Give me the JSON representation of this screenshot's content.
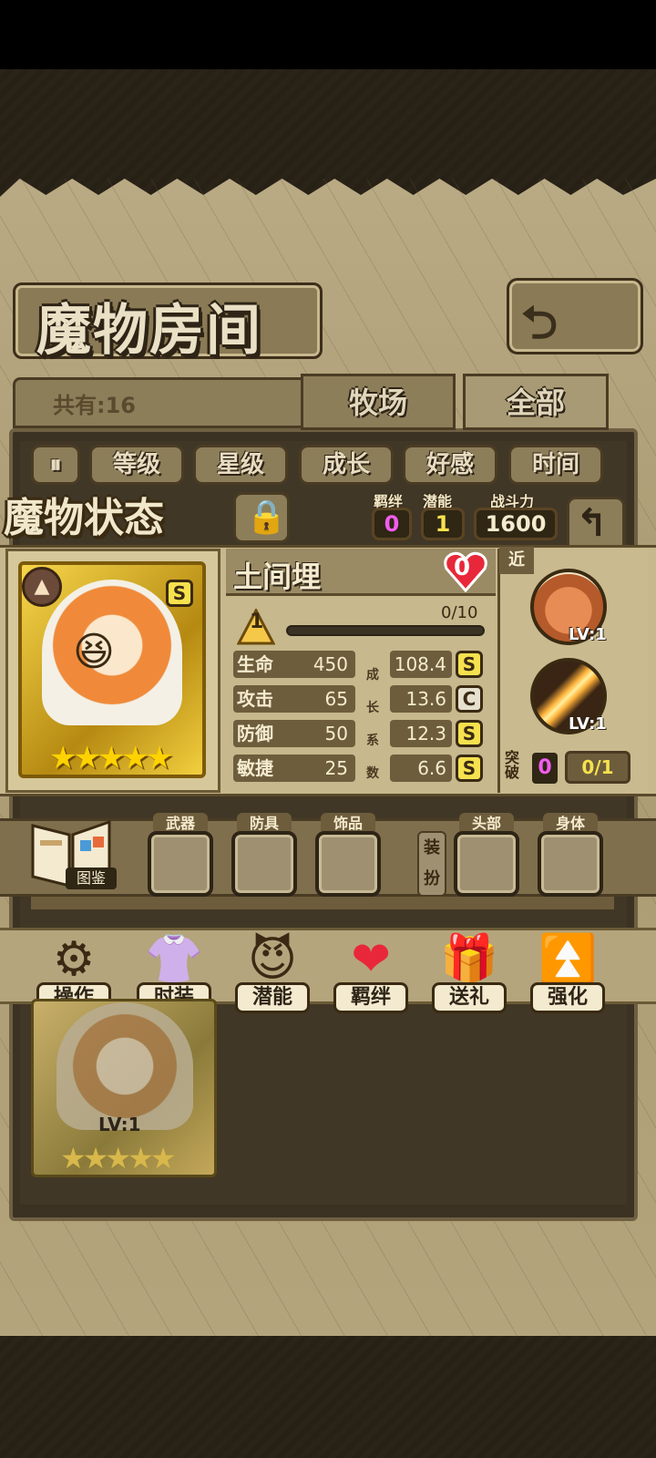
{
  "header": {
    "title": "魔物房间",
    "back_icon": "return-arrow-icon"
  },
  "list": {
    "count_label": "共有:16",
    "tabs": [
      "牧场",
      "全部"
    ],
    "sort_toggle_icon": "sort-toggle-icon",
    "sort_buttons": [
      "等级",
      "星级",
      "成长",
      "好感",
      "时间"
    ],
    "card": {
      "level": "LV:1",
      "stars": "★★★★★"
    }
  },
  "status": {
    "title": "魔物状态",
    "lock_icon": "🔒",
    "bond_label": "羁绊",
    "bond_value": "0",
    "potential_label": "潜能",
    "potential_value": "1",
    "power_label": "战斗力",
    "power_value": "1600",
    "name": "土间埋",
    "affection": "0",
    "element_icon": "mountain-element-icon",
    "rank": "S",
    "stars": "★★★★★",
    "level": "1",
    "exp": "0/10",
    "exp_progress": 0,
    "growth_chars": [
      "成",
      "长",
      "系",
      "数"
    ],
    "stats": [
      {
        "label": "生命",
        "value": "450",
        "growth": "108.4",
        "grade": "S"
      },
      {
        "label": "攻击",
        "value": "65",
        "growth": "13.6",
        "grade": "C"
      },
      {
        "label": "防御",
        "value": "50",
        "growth": "12.3",
        "grade": "S"
      },
      {
        "label": "敏捷",
        "value": "25",
        "growth": "6.6",
        "grade": "S"
      }
    ],
    "range_tag": "近",
    "skills": [
      {
        "icon": "fist-skill-icon",
        "level": "LV:1"
      },
      {
        "icon": "slash-skill-icon",
        "level": "LV:1"
      }
    ],
    "breakthrough_label": "突破",
    "breakthrough_value": "0",
    "breakthrough_count": "0/1"
  },
  "equipment": {
    "book_label": "图鉴",
    "slots": [
      "武器",
      "防具",
      "饰品",
      "头部",
      "身体"
    ],
    "dress_label": "装扮"
  },
  "actions": [
    {
      "label": "操作",
      "icon": "⚙"
    },
    {
      "label": "时装",
      "icon": "👚"
    },
    {
      "label": "潜能",
      "icon": "😈"
    },
    {
      "label": "羁绊",
      "icon": "❤"
    },
    {
      "label": "送礼",
      "icon": "🎁"
    },
    {
      "label": "强化",
      "icon": "⏫"
    }
  ],
  "colors": {
    "accent_gold": "#f6e14e",
    "affection_red": "#e8283a",
    "break_pink": "#f25cf0"
  }
}
